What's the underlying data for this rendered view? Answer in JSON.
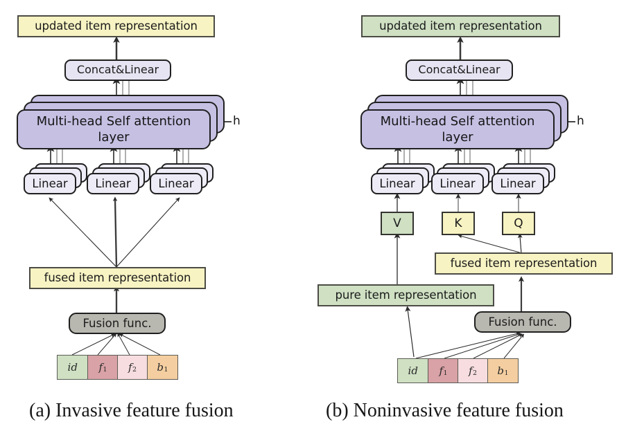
{
  "figure": {
    "panels": [
      {
        "id": "a",
        "caption": "(a) Invasive feature fusion",
        "top_box": {
          "label": "updated item representation",
          "color": "#f7f3c3"
        },
        "concat": {
          "label": "Concat&Linear"
        },
        "attention": {
          "label": "Multi-head Self attention\nlayer",
          "heads_label": "h",
          "color": "#c6c0e3"
        },
        "linear": [
          {
            "label": "Linear"
          },
          {
            "label": "Linear"
          },
          {
            "label": "Linear"
          }
        ],
        "fused_box": {
          "label": "fused item representation",
          "color": "#f7f3c3"
        },
        "fusion_func": {
          "label": "Fusion func.",
          "color": "#b8b7b0"
        },
        "tokens": [
          {
            "label": "id",
            "sub": "",
            "color": "#cfe0c3"
          },
          {
            "label": "f",
            "sub": "1",
            "color": "#d9a2a6"
          },
          {
            "label": "f",
            "sub": "2",
            "color": "#f7dde0"
          },
          {
            "label": "b",
            "sub": "1",
            "color": "#f4ceA0"
          }
        ]
      },
      {
        "id": "b",
        "caption": "(b) Noninvasive feature fusion",
        "top_box": {
          "label": "updated item representation",
          "color": "#cfe0c3"
        },
        "concat": {
          "label": "Concat&Linear"
        },
        "attention": {
          "label": "Multi-head Self attention\nlayer",
          "heads_label": "h",
          "color": "#c6c0e3"
        },
        "linear": [
          {
            "label": "Linear"
          },
          {
            "label": "Linear"
          },
          {
            "label": "Linear"
          }
        ],
        "vkq": [
          {
            "label": "V",
            "color": "#cfe0c3"
          },
          {
            "label": "K",
            "color": "#f7f3c3"
          },
          {
            "label": "Q",
            "color": "#f7f3c3"
          }
        ],
        "fused_box": {
          "label": "fused item representation",
          "color": "#f7f3c3"
        },
        "pure_box": {
          "label": "pure item representation",
          "color": "#cfe0c3"
        },
        "fusion_func": {
          "label": "Fusion func.",
          "color": "#b8b7b0"
        },
        "tokens": [
          {
            "label": "id",
            "sub": "",
            "color": "#cfe0c3"
          },
          {
            "label": "f",
            "sub": "1",
            "color": "#d9a2a6"
          },
          {
            "label": "f",
            "sub": "2",
            "color": "#f7dde0"
          },
          {
            "label": "b",
            "sub": "1",
            "color": "#f4ceA0"
          }
        ]
      }
    ]
  }
}
